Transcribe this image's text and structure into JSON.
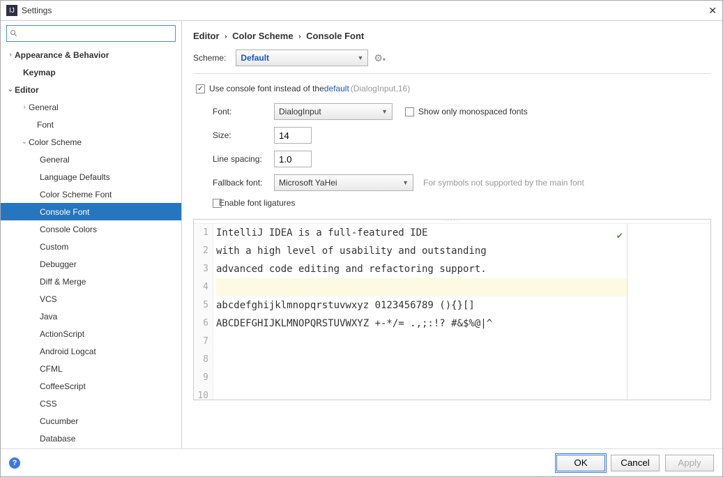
{
  "window": {
    "title": "Settings"
  },
  "search": {
    "value": ""
  },
  "tree": {
    "appearance": "Appearance & Behavior",
    "keymap": "Keymap",
    "editor": "Editor",
    "general": "General",
    "font": "Font",
    "colorScheme": "Color Scheme",
    "cs_general": "General",
    "cs_langDefaults": "Language Defaults",
    "cs_schemeFont": "Color Scheme Font",
    "cs_consoleFont": "Console Font",
    "cs_consoleColors": "Console Colors",
    "cs_custom": "Custom",
    "cs_debugger": "Debugger",
    "cs_diffMerge": "Diff & Merge",
    "cs_vcs": "VCS",
    "cs_java": "Java",
    "cs_actionScript": "ActionScript",
    "cs_androidLogcat": "Android Logcat",
    "cs_cfml": "CFML",
    "cs_coffeeScript": "CoffeeScript",
    "cs_css": "CSS",
    "cs_cucumber": "Cucumber",
    "cs_database": "Database"
  },
  "breadcrumb": {
    "p1": "Editor",
    "p2": "Color Scheme",
    "p3": "Console Font"
  },
  "scheme": {
    "label": "Scheme:",
    "value": "Default"
  },
  "useConsole": {
    "label_pre": "Use console font instead of the ",
    "link": "default",
    "hint": " (DialogInput,16)"
  },
  "fields": {
    "fontLabel": "Font:",
    "fontValue": "DialogInput",
    "monoLabel": "Show only monospaced fonts",
    "sizeLabel": "Size:",
    "sizeValue": "14",
    "lineSpacingLabel": "Line spacing:",
    "lineSpacingValue": "1.0",
    "fallbackLabel": "Fallback font:",
    "fallbackValue": "Microsoft YaHei",
    "fallbackHint": "For symbols not supported by the main font",
    "ligaturesLabel": "Enable font ligatures"
  },
  "preview": {
    "lines": [
      "IntelliJ IDEA is a full-featured IDE",
      "with a high level of usability and outstanding",
      "advanced code editing and refactoring support.",
      "",
      "abcdefghijklmnopqrstuvwxyz 0123456789 (){}[]",
      "ABCDEFGHIJKLMNOPQRSTUVWXYZ +-*/= .,;:!? #&$%@|^",
      "",
      "",
      "",
      ""
    ],
    "hlIndex": 3
  },
  "buttons": {
    "ok": "OK",
    "cancel": "Cancel",
    "apply": "Apply"
  }
}
